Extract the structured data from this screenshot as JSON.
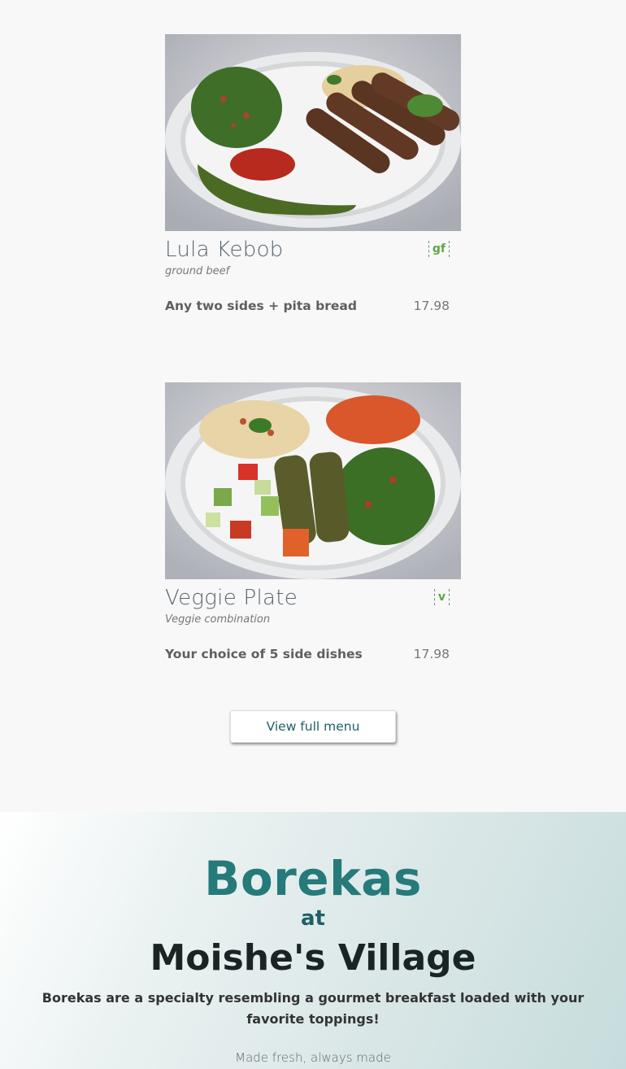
{
  "menu_items": [
    {
      "title": "Lula Kebob",
      "badge": "gf",
      "subtitle": "ground beef",
      "description": "Any two sides + pita bread",
      "price": "17.98",
      "image": "lula-kebob-plate"
    },
    {
      "title": "Veggie Plate",
      "badge": "v",
      "subtitle": "Veggie combination",
      "description": "Your choice of 5 side dishes",
      "price": "17.98",
      "image": "veggie-plate"
    }
  ],
  "view_menu_label": "View full menu",
  "boreka": {
    "heading": "Borekas",
    "connector": "at",
    "place": "Moishe's Village",
    "description": "Borekas are a specialty resembling a gourmet breakfast loaded with your favorite toppings!",
    "more_text": "Made fresh, always made"
  },
  "colors": {
    "teal_accent": "#267a7a",
    "badge_green": "#5fa548",
    "page_bg": "#f8f8f8"
  }
}
